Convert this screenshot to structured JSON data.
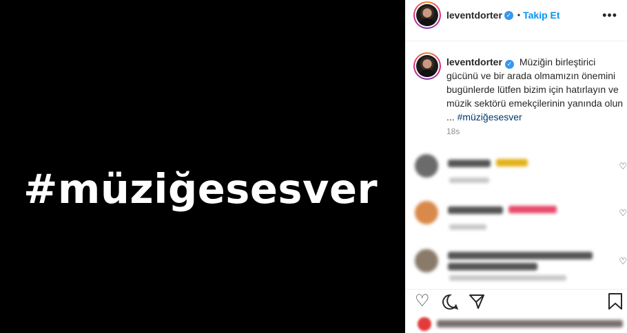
{
  "media": {
    "hashtag_text": "#müziğesesver"
  },
  "header": {
    "username": "leventdorter",
    "separator": "•",
    "follow_label": "Takip Et",
    "more_icon": "more-horizontal-icon"
  },
  "caption": {
    "username": "leventdorter",
    "text": "Müziğin birleştirici gücünü ve bir arada olmamızın önemini bugünlerde lütfen bizim için hatırlayın ve müzik sektörü emekçilerinin yanında olun ...",
    "hashtag": "#müziğesesver",
    "time": "18s"
  },
  "comments": [
    {
      "blurred": true,
      "avatar_color": "#6b6b6b",
      "accent_color": "#e3b21a"
    },
    {
      "blurred": true,
      "avatar_color": "#d98a4a",
      "accent_color": "#e84a6a"
    },
    {
      "blurred": true,
      "avatar_color": "#8a7a6a",
      "accent_color": "#9a9a9a"
    }
  ],
  "actions": {
    "like_icon": "heart-icon",
    "comment_icon": "comment-icon",
    "share_icon": "share-icon",
    "save_icon": "bookmark-icon"
  },
  "colors": {
    "link": "#0095f6",
    "hashtag": "#00376b",
    "verified": "#3897f0",
    "muted": "#8e8e8e"
  }
}
